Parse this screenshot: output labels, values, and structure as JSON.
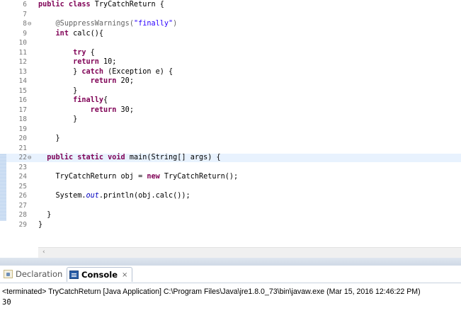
{
  "editor": {
    "lines": [
      {
        "num": "6",
        "parts": [
          [
            "kw",
            "public class "
          ],
          [
            "",
            "TryCatchReturn {"
          ]
        ]
      },
      {
        "num": "7",
        "parts": []
      },
      {
        "num": "8",
        "fold": "⊖",
        "parts": [
          [
            "",
            "    "
          ],
          [
            "ann",
            "@SuppressWarnings("
          ],
          [
            "str",
            "\"finally\""
          ],
          [
            "ann",
            ")"
          ]
        ]
      },
      {
        "num": "9",
        "parts": [
          [
            "",
            "    "
          ],
          [
            "kw",
            "int "
          ],
          [
            "",
            "calc(){"
          ]
        ]
      },
      {
        "num": "10",
        "parts": []
      },
      {
        "num": "11",
        "parts": [
          [
            "",
            "        "
          ],
          [
            "kw",
            "try "
          ],
          [
            "",
            "{"
          ]
        ]
      },
      {
        "num": "12",
        "parts": [
          [
            "",
            "        "
          ],
          [
            "kw",
            "return "
          ],
          [
            "",
            "10;"
          ]
        ]
      },
      {
        "num": "13",
        "parts": [
          [
            "",
            "        } "
          ],
          [
            "kw",
            "catch "
          ],
          [
            "",
            "(Exception e) {"
          ]
        ]
      },
      {
        "num": "14",
        "parts": [
          [
            "",
            "            "
          ],
          [
            "kw",
            "return "
          ],
          [
            "",
            "20;"
          ]
        ]
      },
      {
        "num": "15",
        "parts": [
          [
            "",
            "        }"
          ]
        ]
      },
      {
        "num": "16",
        "parts": [
          [
            "",
            "        "
          ],
          [
            "kw",
            "finally"
          ],
          [
            "",
            "{"
          ]
        ]
      },
      {
        "num": "17",
        "parts": [
          [
            "",
            "            "
          ],
          [
            "kw",
            "return "
          ],
          [
            "",
            "30;"
          ]
        ]
      },
      {
        "num": "18",
        "parts": [
          [
            "",
            "        }"
          ]
        ]
      },
      {
        "num": "19",
        "parts": []
      },
      {
        "num": "20",
        "parts": [
          [
            "",
            "    }"
          ]
        ]
      },
      {
        "num": "21",
        "parts": []
      },
      {
        "num": "22",
        "fold": "⊖",
        "highlight": true,
        "parts": [
          [
            "",
            "  "
          ],
          [
            "kw",
            "public static void "
          ],
          [
            "",
            "main(String[] args) {"
          ]
        ]
      },
      {
        "num": "23",
        "parts": []
      },
      {
        "num": "24",
        "parts": [
          [
            "",
            "    TryCatchReturn obj = "
          ],
          [
            "kw",
            "new "
          ],
          [
            "",
            "TryCatchReturn();"
          ]
        ]
      },
      {
        "num": "25",
        "parts": []
      },
      {
        "num": "26",
        "parts": [
          [
            "",
            "    System."
          ],
          [
            "fld",
            "out"
          ],
          [
            "",
            ".println(obj.calc());"
          ]
        ]
      },
      {
        "num": "27",
        "parts": []
      },
      {
        "num": "28",
        "parts": [
          [
            "",
            "  }"
          ]
        ]
      },
      {
        "num": "29",
        "parts": [
          [
            "",
            "}"
          ]
        ]
      }
    ]
  },
  "bottom_panel": {
    "tabs": [
      {
        "label": "Declaration",
        "icon": "declaration-icon",
        "active": false
      },
      {
        "label": "Console",
        "icon": "console-icon",
        "active": true,
        "close": "⨯"
      }
    ],
    "status": "<terminated> TryCatchReturn [Java Application] C:\\Program Files\\Java\\jre1.8.0_73\\bin\\javaw.exe (Mar 15, 2016 12:46:22 PM)",
    "output": "30"
  },
  "scrollbar": {
    "left_arrow": "‹"
  },
  "colors": {
    "keyword": "#7f0055",
    "string": "#2a00ff",
    "annotation": "#646464",
    "static_field": "#0000c0",
    "line_highlight": "#e8f2fe"
  }
}
